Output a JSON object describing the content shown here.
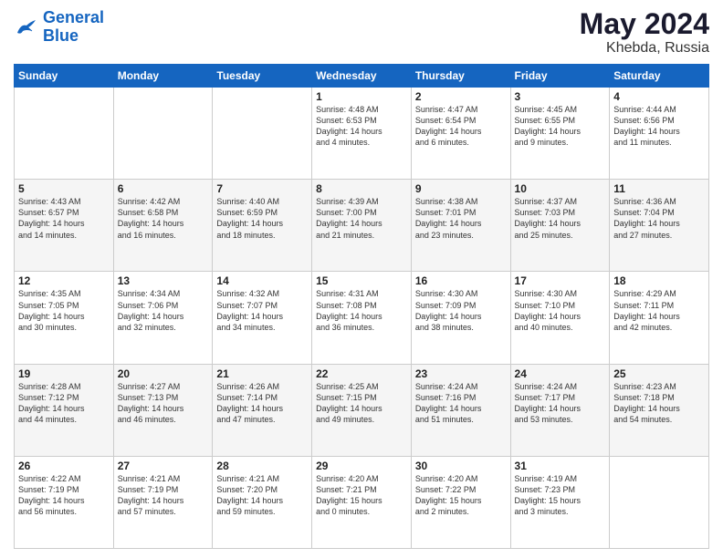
{
  "logo": {
    "line1": "General",
    "line2": "Blue"
  },
  "title": "May 2024",
  "location": "Khebda, Russia",
  "days_header": [
    "Sunday",
    "Monday",
    "Tuesday",
    "Wednesday",
    "Thursday",
    "Friday",
    "Saturday"
  ],
  "weeks": [
    [
      {
        "day": "",
        "info": ""
      },
      {
        "day": "",
        "info": ""
      },
      {
        "day": "",
        "info": ""
      },
      {
        "day": "1",
        "info": "Sunrise: 4:48 AM\nSunset: 6:53 PM\nDaylight: 14 hours\nand 4 minutes."
      },
      {
        "day": "2",
        "info": "Sunrise: 4:47 AM\nSunset: 6:54 PM\nDaylight: 14 hours\nand 6 minutes."
      },
      {
        "day": "3",
        "info": "Sunrise: 4:45 AM\nSunset: 6:55 PM\nDaylight: 14 hours\nand 9 minutes."
      },
      {
        "day": "4",
        "info": "Sunrise: 4:44 AM\nSunset: 6:56 PM\nDaylight: 14 hours\nand 11 minutes."
      }
    ],
    [
      {
        "day": "5",
        "info": "Sunrise: 4:43 AM\nSunset: 6:57 PM\nDaylight: 14 hours\nand 14 minutes."
      },
      {
        "day": "6",
        "info": "Sunrise: 4:42 AM\nSunset: 6:58 PM\nDaylight: 14 hours\nand 16 minutes."
      },
      {
        "day": "7",
        "info": "Sunrise: 4:40 AM\nSunset: 6:59 PM\nDaylight: 14 hours\nand 18 minutes."
      },
      {
        "day": "8",
        "info": "Sunrise: 4:39 AM\nSunset: 7:00 PM\nDaylight: 14 hours\nand 21 minutes."
      },
      {
        "day": "9",
        "info": "Sunrise: 4:38 AM\nSunset: 7:01 PM\nDaylight: 14 hours\nand 23 minutes."
      },
      {
        "day": "10",
        "info": "Sunrise: 4:37 AM\nSunset: 7:03 PM\nDaylight: 14 hours\nand 25 minutes."
      },
      {
        "day": "11",
        "info": "Sunrise: 4:36 AM\nSunset: 7:04 PM\nDaylight: 14 hours\nand 27 minutes."
      }
    ],
    [
      {
        "day": "12",
        "info": "Sunrise: 4:35 AM\nSunset: 7:05 PM\nDaylight: 14 hours\nand 30 minutes."
      },
      {
        "day": "13",
        "info": "Sunrise: 4:34 AM\nSunset: 7:06 PM\nDaylight: 14 hours\nand 32 minutes."
      },
      {
        "day": "14",
        "info": "Sunrise: 4:32 AM\nSunset: 7:07 PM\nDaylight: 14 hours\nand 34 minutes."
      },
      {
        "day": "15",
        "info": "Sunrise: 4:31 AM\nSunset: 7:08 PM\nDaylight: 14 hours\nand 36 minutes."
      },
      {
        "day": "16",
        "info": "Sunrise: 4:30 AM\nSunset: 7:09 PM\nDaylight: 14 hours\nand 38 minutes."
      },
      {
        "day": "17",
        "info": "Sunrise: 4:30 AM\nSunset: 7:10 PM\nDaylight: 14 hours\nand 40 minutes."
      },
      {
        "day": "18",
        "info": "Sunrise: 4:29 AM\nSunset: 7:11 PM\nDaylight: 14 hours\nand 42 minutes."
      }
    ],
    [
      {
        "day": "19",
        "info": "Sunrise: 4:28 AM\nSunset: 7:12 PM\nDaylight: 14 hours\nand 44 minutes."
      },
      {
        "day": "20",
        "info": "Sunrise: 4:27 AM\nSunset: 7:13 PM\nDaylight: 14 hours\nand 46 minutes."
      },
      {
        "day": "21",
        "info": "Sunrise: 4:26 AM\nSunset: 7:14 PM\nDaylight: 14 hours\nand 47 minutes."
      },
      {
        "day": "22",
        "info": "Sunrise: 4:25 AM\nSunset: 7:15 PM\nDaylight: 14 hours\nand 49 minutes."
      },
      {
        "day": "23",
        "info": "Sunrise: 4:24 AM\nSunset: 7:16 PM\nDaylight: 14 hours\nand 51 minutes."
      },
      {
        "day": "24",
        "info": "Sunrise: 4:24 AM\nSunset: 7:17 PM\nDaylight: 14 hours\nand 53 minutes."
      },
      {
        "day": "25",
        "info": "Sunrise: 4:23 AM\nSunset: 7:18 PM\nDaylight: 14 hours\nand 54 minutes."
      }
    ],
    [
      {
        "day": "26",
        "info": "Sunrise: 4:22 AM\nSunset: 7:19 PM\nDaylight: 14 hours\nand 56 minutes."
      },
      {
        "day": "27",
        "info": "Sunrise: 4:21 AM\nSunset: 7:19 PM\nDaylight: 14 hours\nand 57 minutes."
      },
      {
        "day": "28",
        "info": "Sunrise: 4:21 AM\nSunset: 7:20 PM\nDaylight: 14 hours\nand 59 minutes."
      },
      {
        "day": "29",
        "info": "Sunrise: 4:20 AM\nSunset: 7:21 PM\nDaylight: 15 hours\nand 0 minutes."
      },
      {
        "day": "30",
        "info": "Sunrise: 4:20 AM\nSunset: 7:22 PM\nDaylight: 15 hours\nand 2 minutes."
      },
      {
        "day": "31",
        "info": "Sunrise: 4:19 AM\nSunset: 7:23 PM\nDaylight: 15 hours\nand 3 minutes."
      },
      {
        "day": "",
        "info": ""
      }
    ]
  ]
}
